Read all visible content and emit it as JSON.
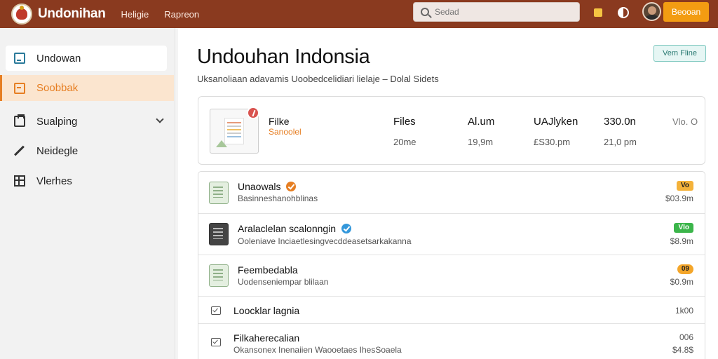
{
  "header": {
    "brand": "Undonihan",
    "nav": [
      "Heligie",
      "Rapreon"
    ],
    "search_placeholder": "Sedad",
    "action_button": "Beooan"
  },
  "sidebar": {
    "items": [
      {
        "label": "Undowan"
      },
      {
        "label": "Soobbak"
      },
      {
        "label": "Sualping"
      },
      {
        "label": "Neidegle"
      },
      {
        "label": "Vlerhes"
      }
    ]
  },
  "main": {
    "title": "Undouhan Indonsia",
    "subtitle": "Uksanoliaan adavamis Uoobedcelidiari lielaje – Dolal Sidets",
    "top_button": "Vem Fline",
    "summary": {
      "name": "Filke",
      "sub": "Sanoolel",
      "columns": [
        {
          "label": "Files",
          "value": "20me"
        },
        {
          "label": "Al.um",
          "value": "19,9m"
        },
        {
          "label": "UAJlyken",
          "value": "£S30.pm"
        },
        {
          "label": "330.0n",
          "value": "21,0 pm"
        }
      ],
      "last": "Vlo. O"
    },
    "rows": [
      {
        "name": "Unaowals",
        "desc": "Basinneshanohblinas",
        "chip": "Vo",
        "size": "$03.9m"
      },
      {
        "name": "Aralaclelan scalonngin",
        "desc": "Ooleniave Inciaetlesingvecddeasetsarkakanna",
        "chip": "Vlo",
        "size": "$8.9m"
      },
      {
        "name": "Feembedabla",
        "desc": "Uodenseniempar blilaan",
        "chip": "09",
        "size": "$0.9m"
      },
      {
        "name": "Loocklar lagnia",
        "desc": "",
        "chip": "",
        "size": "1k00"
      },
      {
        "name": "Filkaherecalian",
        "desc": "Okansonex Inenaiien Waooetaes IhesSoaela",
        "chip": "",
        "size": "006",
        "size2": "$4.8$"
      }
    ]
  }
}
